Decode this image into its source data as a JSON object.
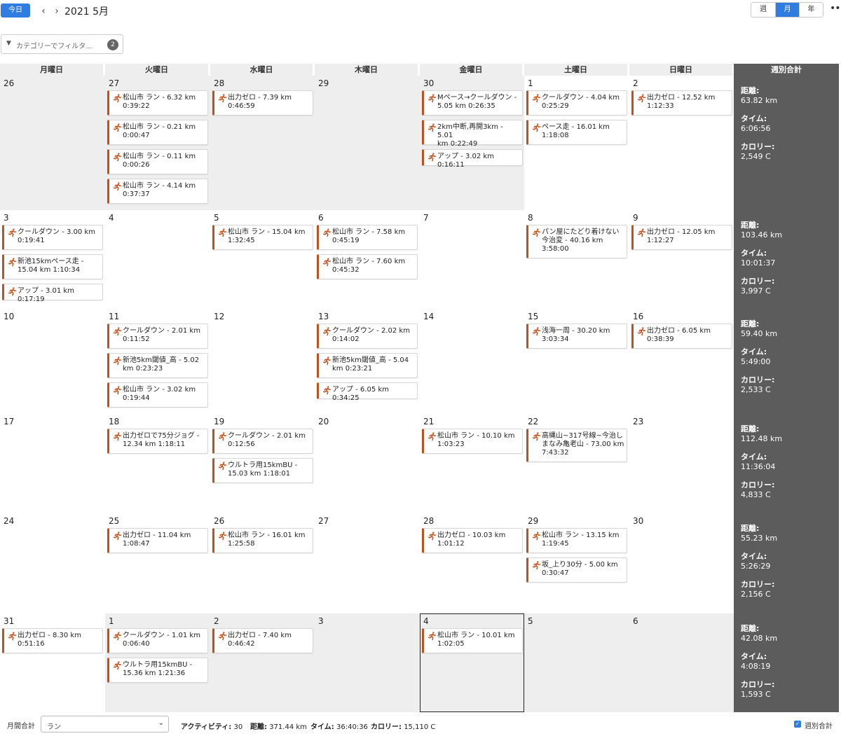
{
  "header": {
    "today_label": "今日",
    "prev_icon": "chevron-left-icon",
    "next_icon": "chevron-right-icon",
    "title": "2021 5月",
    "views": [
      {
        "label": "週",
        "active": false
      },
      {
        "label": "月",
        "active": true
      },
      {
        "label": "年",
        "active": false
      }
    ],
    "more_icon": "more-icon"
  },
  "filter": {
    "placeholder": "カテゴリーでフィルタ...",
    "count": "2"
  },
  "weekdays": [
    "月曜日",
    "火曜日",
    "水曜日",
    "木曜日",
    "金曜日",
    "土曜日",
    "日曜日"
  ],
  "weekly_total_header": "週別合計",
  "labels": {
    "distance": "距離:",
    "time": "タイム:",
    "calories": "カロリー:"
  },
  "accent_color": "#c0501e",
  "weeks": [
    {
      "days": [
        {
          "num": "26",
          "other": true,
          "activities": []
        },
        {
          "num": "27",
          "other": true,
          "activities": [
            "松山市 ラン - 6.32 km\n0:39:22",
            "松山市 ラン - 0.21 km\n0:00:47",
            "松山市 ラン - 0.11 km\n0:00:26",
            "松山市 ラン - 4.14 km\n0:37:37"
          ]
        },
        {
          "num": "28",
          "other": true,
          "activities": [
            "出力ゼロ - 7.39 km\n0:46:59"
          ]
        },
        {
          "num": "29",
          "other": true,
          "activities": []
        },
        {
          "num": "30",
          "other": true,
          "activities": [
            "Mペース→クールダウン -\n5.05 km 0:26:35",
            "2km中断,再開3km - 5.01\nkm 0:22:49",
            "アップ - 3.02 km 0:16:11"
          ]
        },
        {
          "num": "1",
          "other": false,
          "activities": [
            "クールダウン - 4.04 km\n0:25:29",
            "ペース走 - 16.01 km\n1:18:08"
          ]
        },
        {
          "num": "2",
          "other": false,
          "activities": [
            "出力ゼロ - 12.52 km\n1:12:33"
          ]
        }
      ],
      "total": {
        "distance": "63.82 km",
        "time": "6:06:56",
        "calories": "2,549 C"
      }
    },
    {
      "days": [
        {
          "num": "3",
          "other": false,
          "activities": [
            "クールダウン - 3.00 km\n0:19:41",
            "新池15kmペース走 -\n15.04 km 1:10:34",
            "アップ - 3.01 km 0:17:19"
          ]
        },
        {
          "num": "4",
          "other": false,
          "activities": []
        },
        {
          "num": "5",
          "other": false,
          "activities": [
            "松山市 ラン - 15.04 km\n1:32:45"
          ]
        },
        {
          "num": "6",
          "other": false,
          "activities": [
            "松山市 ラン - 7.58 km\n0:45:19",
            "松山市 ラン - 7.60 km\n0:45:32"
          ]
        },
        {
          "num": "7",
          "other": false,
          "activities": []
        },
        {
          "num": "8",
          "other": false,
          "activities": [
            "パン屋にたどり着けない\n今治変 - 40.16 km\n3:58:00"
          ]
        },
        {
          "num": "9",
          "other": false,
          "activities": [
            "出力ゼロ - 12.05 km\n1:12:27"
          ]
        }
      ],
      "total": {
        "distance": "103.46 km",
        "time": "10:01:37",
        "calories": "3,997 C"
      }
    },
    {
      "days": [
        {
          "num": "10",
          "other": false,
          "activities": []
        },
        {
          "num": "11",
          "other": false,
          "activities": [
            "クールダウン - 2.01 km\n0:11:52",
            "新池5km閾値_高 - 5.02\nkm 0:23:23",
            "松山市 ラン - 3.02 km\n0:19:44"
          ]
        },
        {
          "num": "12",
          "other": false,
          "activities": []
        },
        {
          "num": "13",
          "other": false,
          "activities": [
            "クールダウン - 2.02 km\n0:14:02",
            "新池5km閾値_高 - 5.04\nkm 0:23:21",
            "アップ - 6.05 km 0:34:25"
          ]
        },
        {
          "num": "14",
          "other": false,
          "activities": []
        },
        {
          "num": "15",
          "other": false,
          "activities": [
            "浅海一周 - 30.20 km\n3:03:34"
          ]
        },
        {
          "num": "16",
          "other": false,
          "activities": [
            "出力ゼロ - 6.05 km\n0:38:39"
          ]
        }
      ],
      "total": {
        "distance": "59.40 km",
        "time": "5:49:00",
        "calories": "2,533 C"
      }
    },
    {
      "days": [
        {
          "num": "17",
          "other": false,
          "activities": []
        },
        {
          "num": "18",
          "other": false,
          "activities": [
            "出力ゼロで75分ジョグ -\n12.34 km 1:18:11"
          ]
        },
        {
          "num": "19",
          "other": false,
          "activities": [
            "クールダウン - 2.01 km\n0:12:56",
            "ウルトラ用15kmBU -\n15.03 km 1:18:01"
          ]
        },
        {
          "num": "20",
          "other": false,
          "activities": []
        },
        {
          "num": "21",
          "other": false,
          "activities": [
            "松山市 ラン - 10.10 km\n1:03:23"
          ]
        },
        {
          "num": "22",
          "other": false,
          "activities": [
            "高縄山~317号線~今治し\nまなみ亀老山 - 73.00 km\n7:43:32"
          ]
        },
        {
          "num": "23",
          "other": false,
          "activities": []
        }
      ],
      "total": {
        "distance": "112.48 km",
        "time": "11:36:04",
        "calories": "4,833 C"
      }
    },
    {
      "days": [
        {
          "num": "24",
          "other": false,
          "activities": []
        },
        {
          "num": "25",
          "other": false,
          "activities": [
            "出力ゼロ - 11.04 km\n1:08:47"
          ]
        },
        {
          "num": "26",
          "other": false,
          "activities": [
            "松山市 ラン - 16.01 km\n1:25:58"
          ]
        },
        {
          "num": "27",
          "other": false,
          "activities": []
        },
        {
          "num": "28",
          "other": false,
          "activities": [
            "出力ゼロ - 10.03 km\n1:01:12"
          ]
        },
        {
          "num": "29",
          "other": false,
          "activities": [
            "松山市 ラン - 13.15 km\n1:19:45",
            "坂_上り30分 - 5.00 km\n0:30:47"
          ]
        },
        {
          "num": "30",
          "other": false,
          "activities": []
        }
      ],
      "total": {
        "distance": "55.23 km",
        "time": "5:26:29",
        "calories": "2,156 C"
      }
    },
    {
      "days": [
        {
          "num": "31",
          "other": false,
          "activities": [
            "出力ゼロ - 8.30 km\n0:51:16"
          ]
        },
        {
          "num": "1",
          "other": true,
          "activities": [
            "クールダウン - 1.01 km\n0:06:40",
            "ウルトラ用15kmBU -\n15.36 km 1:21:36"
          ]
        },
        {
          "num": "2",
          "other": true,
          "activities": [
            "出力ゼロ - 7.40 km\n0:46:42"
          ]
        },
        {
          "num": "3",
          "other": true,
          "activities": []
        },
        {
          "num": "4",
          "other": true,
          "today": true,
          "activities": [
            "松山市 ラン - 10.01 km\n1:02:05"
          ]
        },
        {
          "num": "5",
          "other": true,
          "activities": []
        },
        {
          "num": "6",
          "other": true,
          "activities": []
        }
      ],
      "total": {
        "distance": "42.08 km",
        "time": "4:08:19",
        "calories": "1,593 C"
      }
    }
  ],
  "footer": {
    "monthly_label": "月間合計",
    "category_value": "ラン",
    "activities_label": "アクティビティ:",
    "activities_value": "30",
    "distance_label": "距離:",
    "distance_value": "371.44 km",
    "time_label": "タイム:",
    "time_value": "36:40:36",
    "calories_label": "カロリー:",
    "calories_value": "15,110 C",
    "weekly_toggle_label": "週別合計",
    "weekly_toggle_checked": true
  }
}
